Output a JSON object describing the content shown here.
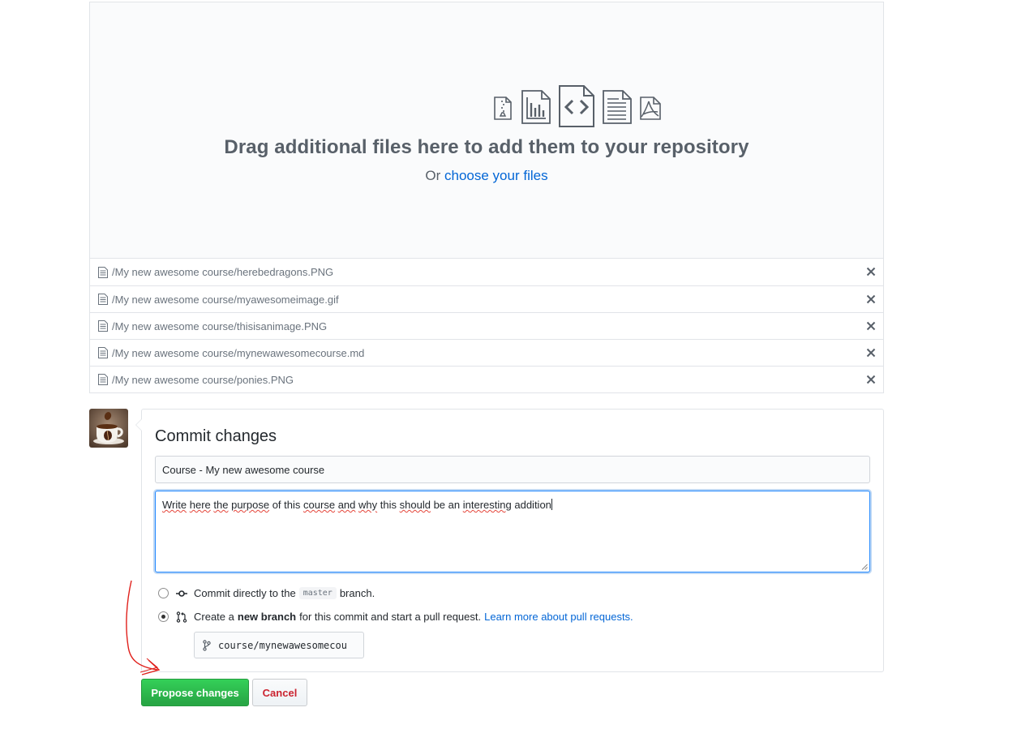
{
  "dropzone": {
    "title": "Drag additional files here to add them to your repository",
    "sub_prefix": "Or",
    "choose_link": "choose your files"
  },
  "files": [
    {
      "path": "/My new awesome course/herebedragons.PNG"
    },
    {
      "path": "/My new awesome course/myawesomeimage.gif"
    },
    {
      "path": "/My new awesome course/thisisanimage.PNG"
    },
    {
      "path": "/My new awesome course/mynewawesomecourse.md"
    },
    {
      "path": "/My new awesome course/ponies.PNG"
    }
  ],
  "commit": {
    "title": "Commit changes",
    "summary_value": "Course - My new awesome course",
    "description_words": [
      "Write",
      "here",
      "the",
      "purpose",
      "of",
      "this",
      "course",
      "and",
      "why",
      "this",
      "should",
      "be",
      "an",
      "interesting",
      "addition"
    ],
    "option_direct": {
      "prefix": "Commit directly to the",
      "branch": "master",
      "suffix": "branch.",
      "selected": false
    },
    "option_new_branch": {
      "prefix": "Create a",
      "bold": "new branch",
      "suffix": "for this commit and start a pull request.",
      "link": "Learn more about pull requests.",
      "selected": true
    },
    "branch_name_value": "course/mynewawesomecou"
  },
  "buttons": {
    "propose": "Propose changes",
    "cancel": "Cancel"
  },
  "colors": {
    "link": "#0366d6",
    "primary_green": "#28a745",
    "cancel_red": "#cb2431",
    "annotation_red": "#e0201b"
  }
}
